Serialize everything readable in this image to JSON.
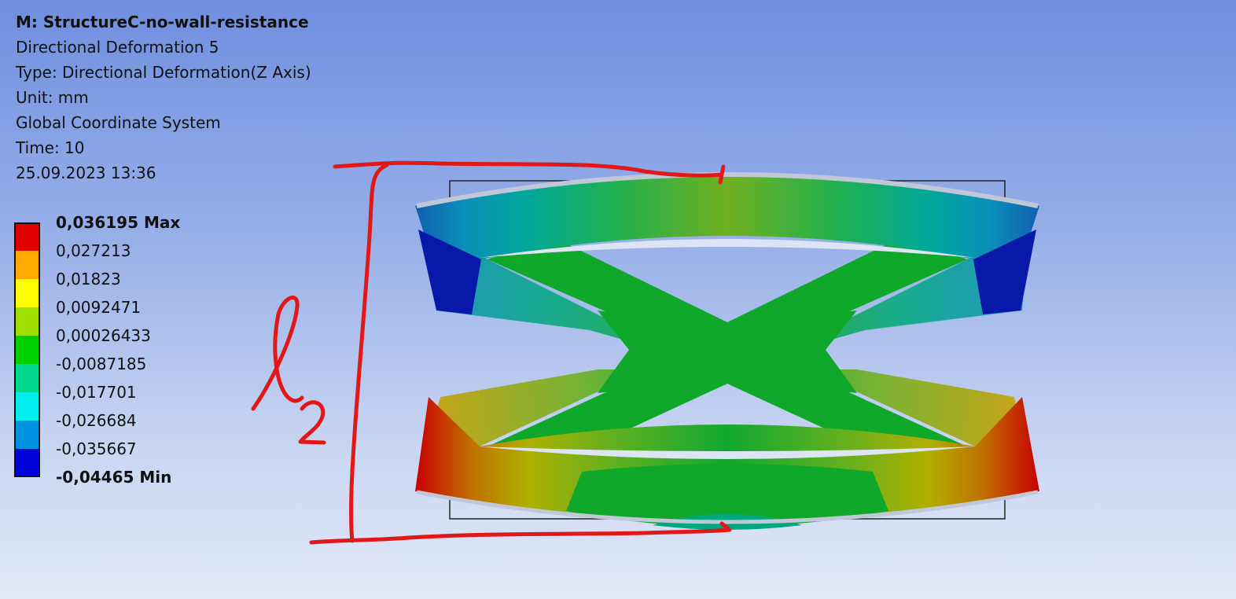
{
  "info": {
    "model": "M: StructureC-no-wall-resistance",
    "result": "Directional Deformation 5",
    "type": "Type: Directional Deformation(Z Axis)",
    "unit": "Unit: mm",
    "coordinate_system": "Global Coordinate System",
    "time": "Time: 10",
    "timestamp": "25.09.2023 13:36"
  },
  "legend": {
    "labels": [
      "0,036195 Max",
      "0,027213",
      "0,01823",
      "0,0092471",
      "0,00026433",
      "-0,0087185",
      "-0,017701",
      "-0,026684",
      "-0,035667",
      "-0,04465 Min"
    ],
    "colors": [
      "#e00000",
      "#ffaa00",
      "#ffff00",
      "#a0e000",
      "#00d000",
      "#00d890",
      "#00f0f0",
      "#0090e0",
      "#0000d8"
    ]
  },
  "annotation": {
    "symbol": "l",
    "subscript": "2"
  }
}
